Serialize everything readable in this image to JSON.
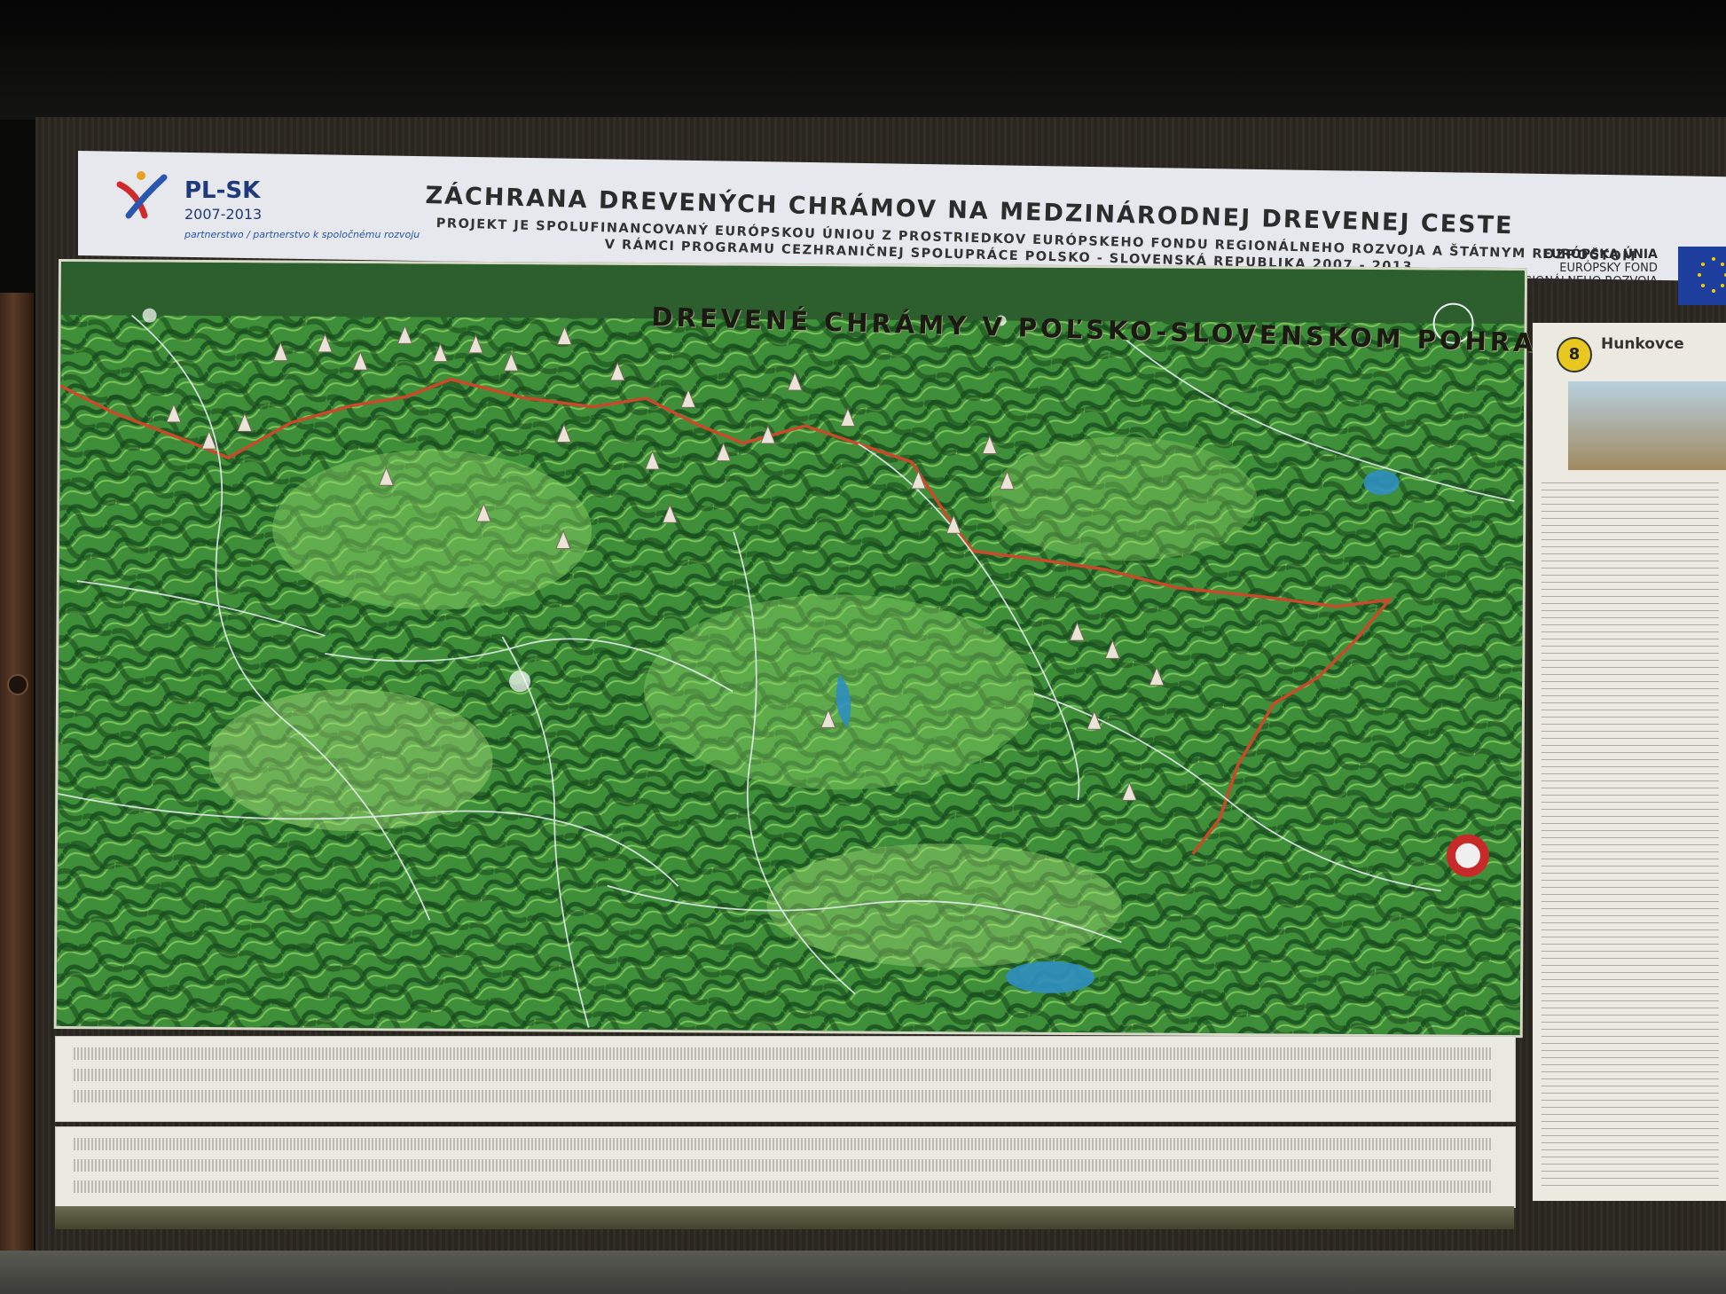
{
  "header": {
    "logo_title": "PL-SK",
    "logo_years": "2007-2013",
    "logo_tagline": "partnerstwo / partnerstvo k spoločnému rozvoju",
    "title": "ZÁCHRANA DREVENÝCH CHRÁMOV NA MEDZINÁRODNEJ DREVENEJ CESTE",
    "subtitle_1": "PROJEKT JE SPOLUFINANCOVANÝ EURÓPSKOU ÚNIOU Z PROSTRIEDKOV EURÓPSKEHO FONDU REGIONÁLNEHO ROZVOJA A ŠTÁTNYM ROZPOČTOM",
    "subtitle_2": "V RÁMCI PROGRAMU CEZHRANIČNEJ SPOLUPRÁCE POLSKO - SLOVENSKÁ REPUBLIKA 2007 - 2013",
    "eu_line_1": "EURÓPSKA ÚNIA",
    "eu_line_2": "EURÓPSKY FOND",
    "eu_line_3": "REGIONÁLNEHO ROZVOJA"
  },
  "map": {
    "title": "DREVENÉ CHRÁMY V POĽSKO-SLOVENSKOM POHRANIČÍ"
  },
  "side_panel": {
    "number": "8",
    "title": "Hunkovce"
  },
  "colors": {
    "border_line": "#c84a2a",
    "map_green": "#3f8f3a",
    "header_bg": "#e6e8ee",
    "flag_blue": "#1e3f9e"
  }
}
